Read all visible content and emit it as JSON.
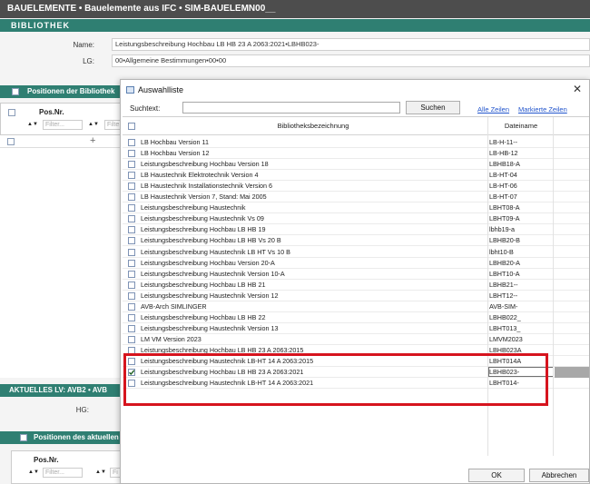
{
  "window": {
    "title": "BAUELEMENTE • Bauelemente aus IFC • SIM-BAUELEMN00__"
  },
  "bibliothek": {
    "section_label": "BIBLIOTHEK",
    "name_label": "Name:",
    "name_value": "Leistungsbeschreibung Hochbau LB HB 23 A 2063:2021•LBHB023-",
    "lg_label": "LG:",
    "lg_value": "00•Allgemeine Bestimmungen•00•00",
    "positions_bar": "Positionen der Bibliothek",
    "posnr_header": "Pos.Nr.",
    "filter_placeholder": "Filter...",
    "filter_placeholder_short": "Filte",
    "plus": "+"
  },
  "aktuelles": {
    "bar_label": "AKTUELLES LV: AVB2 • AVB",
    "hg_label": "HG:",
    "positions_bar": "Positionen des aktuellen",
    "posnr_header": "Pos.Nr.",
    "filter_placeholder": "Filter...",
    "filter_placeholder_short": "Fi"
  },
  "dialog": {
    "title": "Auswahlliste",
    "close": "✕",
    "search_label": "Suchtext:",
    "search_value": "",
    "search_button": "Suchen",
    "all_rows_link": "Alle Zeilen",
    "marked_rows_link": "Markierte Zeilen",
    "col_name": "Bibliotheksbezeichnung",
    "col_file": "Dateiname",
    "rows": [
      {
        "name": "LB Hochbau Version 11",
        "file": "LB-H-11--",
        "checked": false
      },
      {
        "name": "LB Hochbau Version 12",
        "file": "LB-HB-12",
        "checked": false
      },
      {
        "name": "Leistungsbeschreibung Hochbau Version 18",
        "file": "LBHB18-A",
        "checked": false
      },
      {
        "name": "LB Haustechnik Elektrotechnik Version 4",
        "file": "LB-HT-04",
        "checked": false
      },
      {
        "name": "LB Haustechnik Installationstechnik Version 6",
        "file": "LB-HT-06",
        "checked": false
      },
      {
        "name": "LB Haustechnik Version 7, Stand: Mai 2005",
        "file": "LB-HT-07",
        "checked": false
      },
      {
        "name": "Leistungsbeschreibung Haustechnik",
        "file": "LBHT08-A",
        "checked": false
      },
      {
        "name": "Leistungsbeschreibung Haustechnik Vs 09",
        "file": "LBHT09-A",
        "checked": false
      },
      {
        "name": "Leistungsbeschreibung Hochbau LB HB 19",
        "file": "lbhb19-a",
        "checked": false
      },
      {
        "name": "Leistungsbeschreibung Hochbau LB HB Vs 20 B",
        "file": "LBHB20-B",
        "checked": false
      },
      {
        "name": "Leistungsbeschreibung Haustechnik LB HT Vs 10 B",
        "file": "lbht10-B",
        "checked": false
      },
      {
        "name": "Leistungsbeschreibung Hochbau Version 20-A",
        "file": "LBHB20-A",
        "checked": false
      },
      {
        "name": "Leistungsbeschreibung Haustechnik Version 10-A",
        "file": "LBHT10-A",
        "checked": false
      },
      {
        "name": "Leistungsbeschreibung Hochbau LB HB 21",
        "file": "LBHB21--",
        "checked": false
      },
      {
        "name": "Leistungsbeschreibung Haustechnik Version 12",
        "file": "LBHT12--",
        "checked": false
      },
      {
        "name": "AVB-Arch SIMLINGER",
        "file": "AVB-SIM-",
        "checked": false
      },
      {
        "name": "Leistungsbeschreibung Hochbau LB HB 22",
        "file": "LBHB022_",
        "checked": false
      },
      {
        "name": "Leistungsbeschreibung Haustechnik Version 13",
        "file": "LBHT013_",
        "checked": false
      },
      {
        "name": "LM VM Version 2023",
        "file": "LMVM2023",
        "checked": false
      },
      {
        "name": "Leistungsbeschreibung Hochbau LB HB 23 A 2063:2015",
        "file": "LBHB023A",
        "checked": false
      },
      {
        "name": "Leistungsbeschreibung Haustechnik LB-HT 14 A 2063:2015",
        "file": "LBHT014A",
        "checked": false
      },
      {
        "name": "Leistungsbeschreibung Hochbau LB HB 23 A 2063:2021",
        "file": "LBHB023-",
        "checked": true,
        "selected": true
      },
      {
        "name": "Leistungsbeschreibung Haustechnik LB-HT 14 A 2063:2021",
        "file": "LBHT014-",
        "checked": false
      }
    ],
    "ok_button": "OK",
    "cancel_button": "Abbrechen"
  },
  "colors": {
    "accent_green": "#2f7f72",
    "title_gray": "#4d4d4d",
    "highlight_red": "#d6141e",
    "link_blue": "#2255cc"
  }
}
